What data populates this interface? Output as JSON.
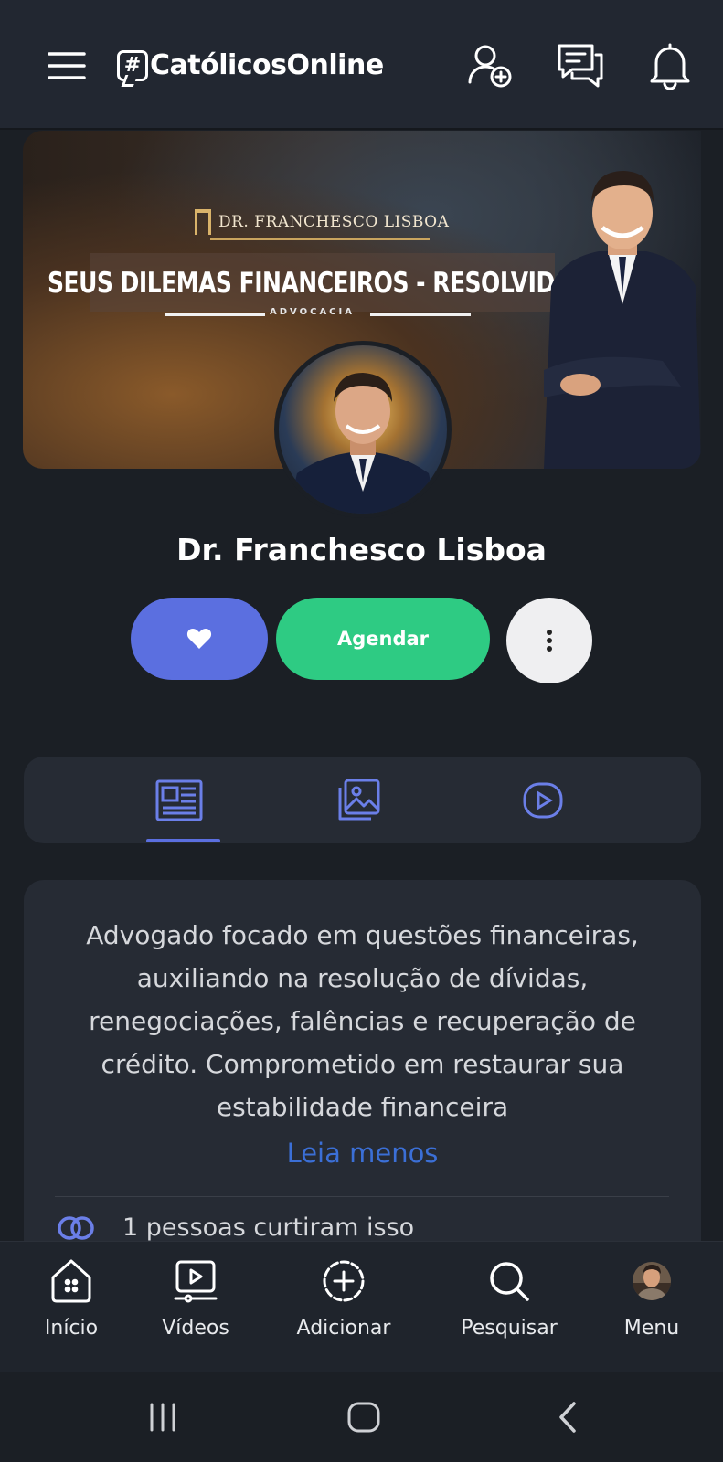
{
  "app": {
    "brand_hash": "#",
    "brand_name": "CatólicosOnline"
  },
  "cover": {
    "brand_line": "DR. FRANCHESCO LISBOA",
    "headline": "SEUS DILEMAS FINANCEIROS - RESOLVIDOS.",
    "subline": "ADVOCACIA"
  },
  "profile": {
    "name": "Dr. Franchesco Lisboa",
    "schedule_label": "Agendar"
  },
  "about": {
    "text": "Advogado focado em questões financeiras, auxiliando na resolução de dívidas, renegociações, falências e recuperação de crédito. Comprometido em restaurar sua estabilidade financeira",
    "toggle_label": "Leia menos",
    "likes_text": "1 pessoas curtiram isso"
  },
  "bottom_nav": [
    {
      "label": "Início",
      "icon": "home-icon"
    },
    {
      "label": "Vídeos",
      "icon": "video-icon"
    },
    {
      "label": "Adicionar",
      "icon": "add-icon"
    },
    {
      "label": "Pesquisar",
      "icon": "search-icon"
    },
    {
      "label": "Menu",
      "icon": "avatar"
    }
  ],
  "colors": {
    "accent": "#5b6fe0",
    "success": "#2ecb83",
    "link": "#3b6fd6",
    "background": "#1b1f25",
    "surface": "#262b34"
  }
}
